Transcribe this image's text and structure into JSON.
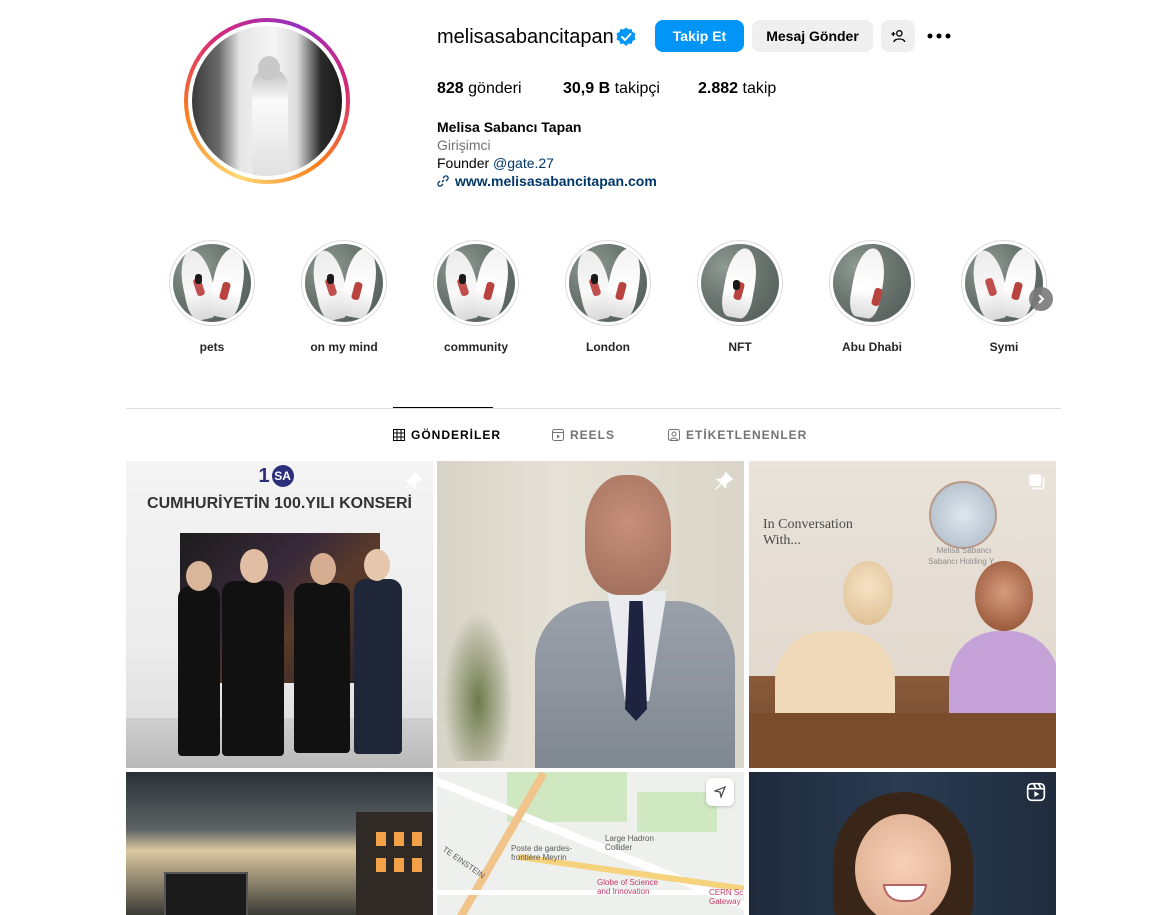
{
  "profile": {
    "username": "melisasabancitapan",
    "follow_label": "Takip Et",
    "message_label": "Mesaj Gönder",
    "stats": {
      "posts_count": "828",
      "posts_label": "gönderi",
      "followers_count": "30,9 B",
      "followers_label": "takipçi",
      "following_count": "2.882",
      "following_label": "takip"
    },
    "full_name": "Melisa Sabancı Tapan",
    "category": "Girişimci",
    "bio_prefix": "Founder",
    "bio_mention": "@gate.27",
    "website": "www.melisasabancitapan.com"
  },
  "highlights": [
    {
      "label": "pets"
    },
    {
      "label": "on my mind"
    },
    {
      "label": "community"
    },
    {
      "label": "London"
    },
    {
      "label": "NFT"
    },
    {
      "label": "Abu Dhabi"
    },
    {
      "label": "Symi"
    }
  ],
  "tabs": {
    "posts": "GÖNDERİLER",
    "reels": "REELS",
    "tagged": "ETİKETLENENLER"
  },
  "posts": {
    "p1_logo": "1",
    "p1_logo_ring": "SA",
    "p1_title": "CUMHURİYETİN 100.YILI KONSERİ",
    "p3_text_line1": "In Conversation",
    "p3_text_line2": "With...",
    "p3_caption_line1": "Melisa Sabancı",
    "p3_caption_line2": "Sabancı Holding Y...",
    "p5_label_lhc_1": "Large Hadron",
    "p5_label_lhc_2": "Collider",
    "p5_label_poste_1": "Poste de gardes-",
    "p5_label_poste_2": "frontière Meyrin",
    "p5_label_globe_1": "Globe of Science",
    "p5_label_globe_2": "and Innovation",
    "p5_label_cern_1": "CERN Sc",
    "p5_label_cern_2": "Gateway",
    "p5_label_street": "TE EINSTEIN"
  },
  "colors": {
    "primary_button": "#0095f6",
    "link": "#00376b",
    "verified": "#0095f6",
    "secondary_text": "#737373"
  },
  "icons": [
    "verified-badge-icon",
    "add-user-icon",
    "more-icon",
    "link-icon",
    "grid-icon",
    "reels-icon",
    "tagged-icon",
    "pin-icon",
    "carousel-icon",
    "chevron-right-icon"
  ]
}
